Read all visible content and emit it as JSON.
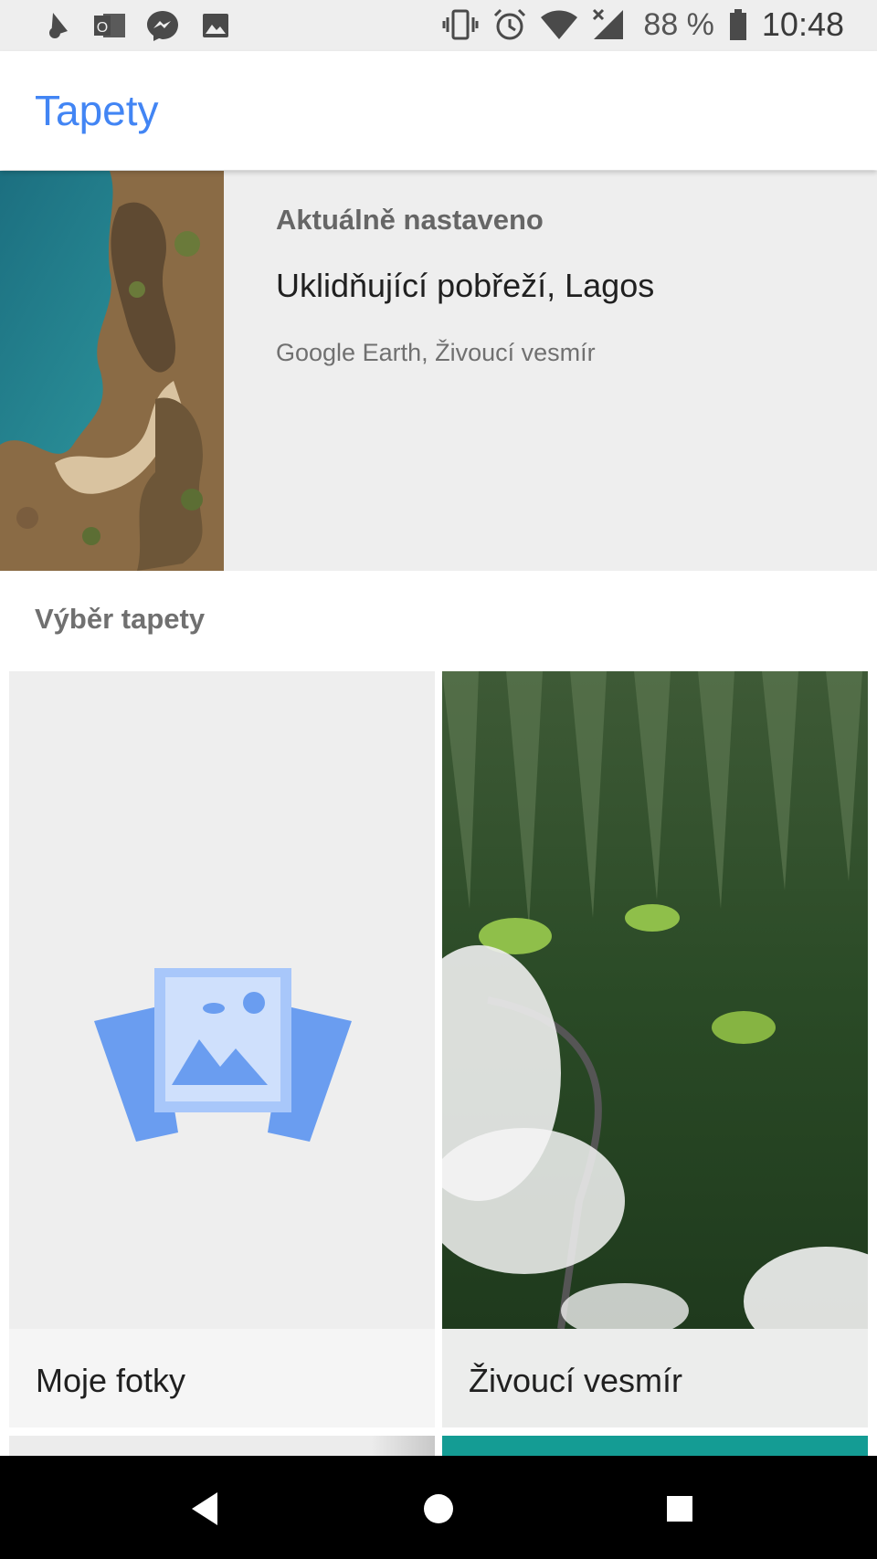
{
  "status_bar": {
    "left_icons": [
      "bell-pen-icon",
      "outlook-icon",
      "messenger-icon",
      "gallery-icon"
    ],
    "right_icons": [
      "vibrate-icon",
      "alarm-icon",
      "wifi-icon",
      "signal-icon",
      "battery-icon"
    ],
    "battery": "88 %",
    "time": "10:48"
  },
  "app_bar": {
    "title": "Tapety"
  },
  "current": {
    "heading": "Aktuálně nastaveno",
    "title": "Uklidňující pobřeží, Lagos",
    "subtitle": "Google Earth, Živoucí vesmír"
  },
  "selection": {
    "label": "Výběr tapety",
    "tiles": [
      {
        "label": "Moje fotky",
        "icon": "photos-stack-icon"
      },
      {
        "label": "Živoucí vesmír",
        "icon": ""
      }
    ]
  },
  "nav_bar": {
    "buttons": [
      "back-icon",
      "home-icon",
      "recents-icon"
    ]
  },
  "colors": {
    "accent": "#4285f4",
    "teal": "#149c94"
  }
}
